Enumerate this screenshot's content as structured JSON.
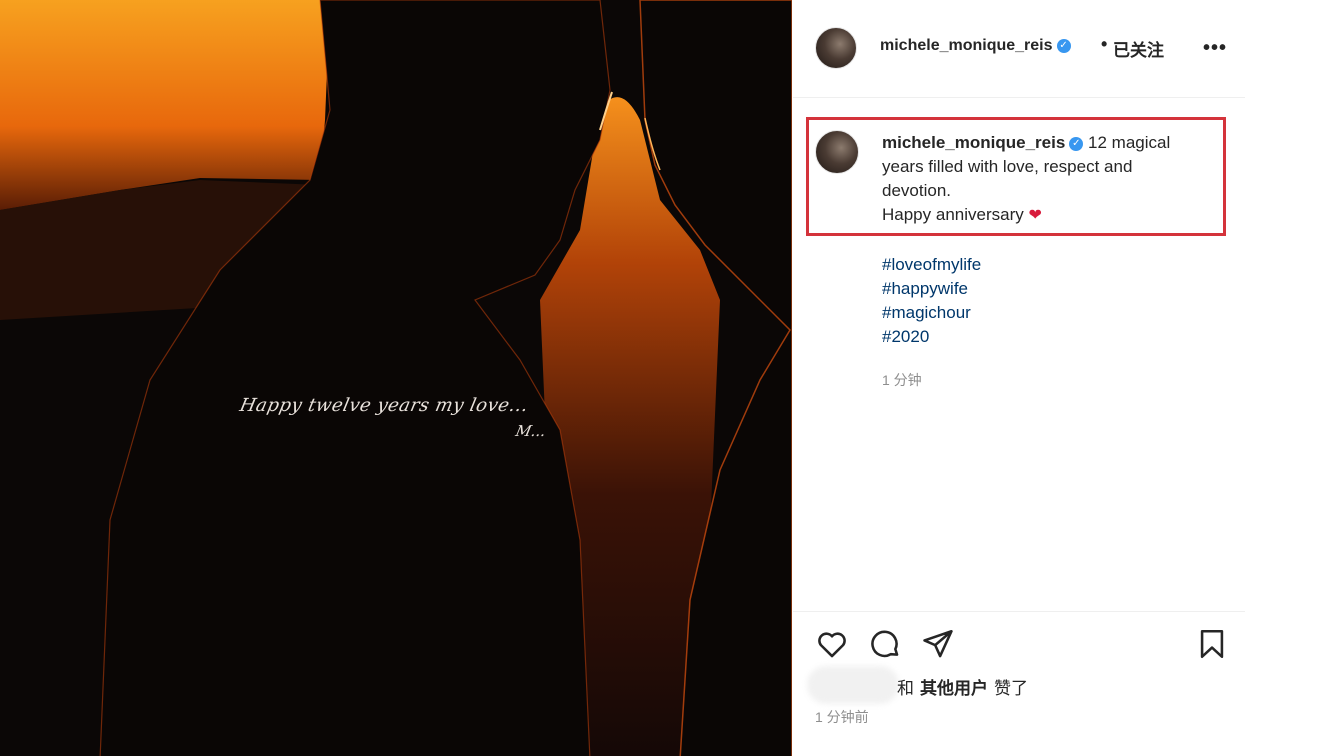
{
  "post": {
    "photo": {
      "caption_script": "Happy twelve years my love...",
      "signature": "M..."
    },
    "header": {
      "username": "michele_monique_reis",
      "verified_icon": "verified-badge-icon",
      "separator": "•",
      "follow_status": "已关注",
      "more_icon": "more-options-icon"
    },
    "caption": {
      "username": "michele_monique_reis",
      "text": "12 magical years filled with love, respect and devotion.",
      "line2": "Happy anniversary",
      "emoji": "❤",
      "hashtags": [
        "#loveofmylife",
        "#happywife",
        "#magichour",
        "#2020"
      ],
      "time": "1 分钟"
    },
    "actions": {
      "like_icon": "heart-outline-icon",
      "comment_icon": "comment-bubble-icon",
      "share_icon": "paper-plane-icon",
      "save_icon": "bookmark-icon"
    },
    "likes": {
      "prefix": "和",
      "others": "其他用户",
      "suffix": "赞了"
    },
    "timestamp": "1 分钟前"
  },
  "colors": {
    "highlight_border": "#d4333b",
    "hashtag": "#00376b",
    "verified": "#3897f0",
    "sunset": "#f28c1e"
  }
}
